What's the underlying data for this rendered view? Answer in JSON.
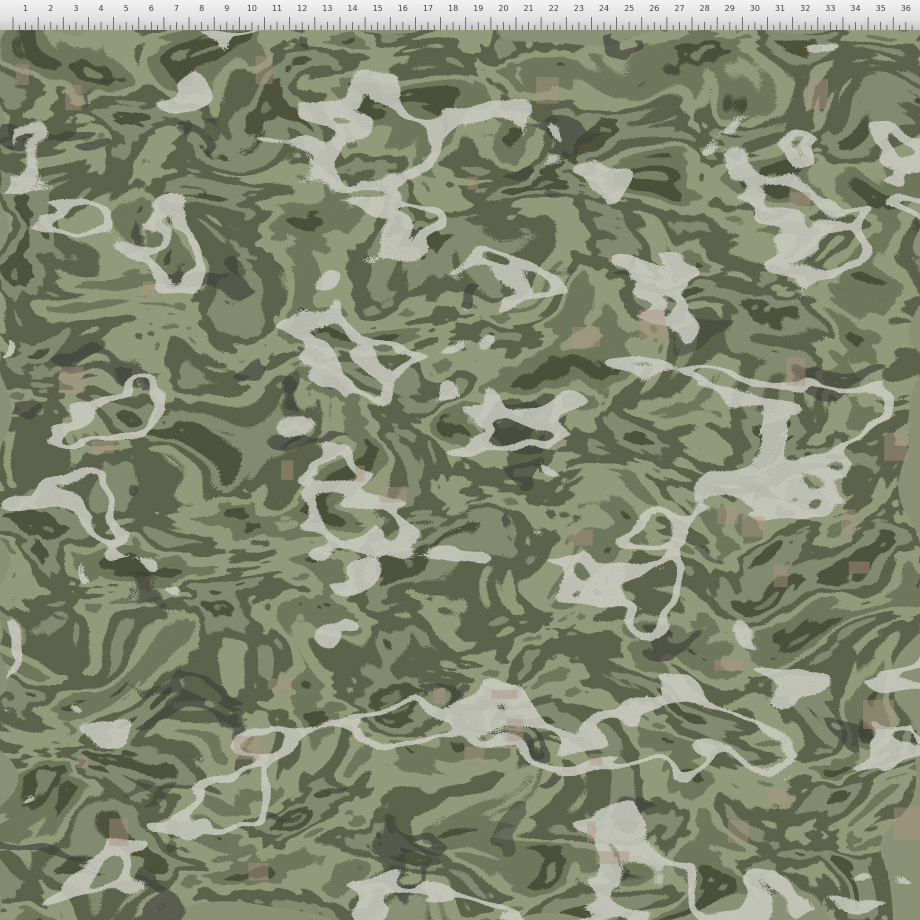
{
  "ruler": {
    "unit": "inch",
    "labels": [
      "1",
      "2",
      "3",
      "4",
      "5",
      "6",
      "7",
      "8",
      "9",
      "10",
      "11",
      "12",
      "13",
      "14",
      "15",
      "16",
      "17",
      "18",
      "19",
      "20",
      "21",
      "22",
      "23",
      "24",
      "25",
      "26",
      "27",
      "28",
      "29",
      "30",
      "31",
      "32",
      "33",
      "34",
      "35",
      "36"
    ]
  },
  "fabric": {
    "pattern": "marbled swirl print",
    "colors": {
      "base": "#8f9979",
      "sage_light": "#aeb895",
      "olive_dark": "#3f452d",
      "charcoal": "#33342f",
      "white_streak": "#dcdcd4",
      "blush_speck": "#b89a86"
    }
  }
}
